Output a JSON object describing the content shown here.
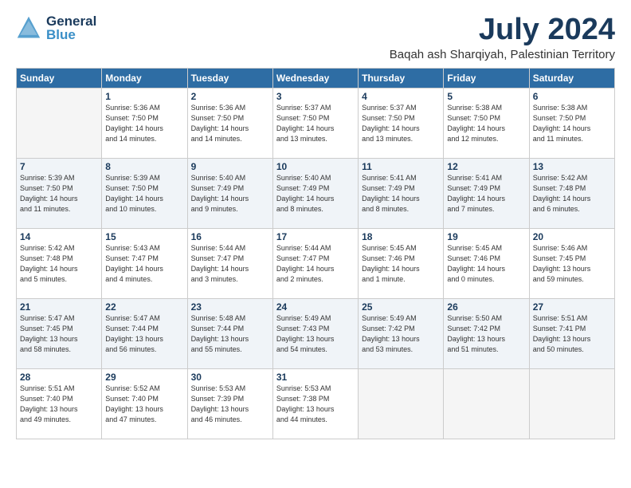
{
  "header": {
    "logo_general": "General",
    "logo_blue": "Blue",
    "month_title": "July 2024",
    "location": "Baqah ash Sharqiyah, Palestinian Territory"
  },
  "days_of_week": [
    "Sunday",
    "Monday",
    "Tuesday",
    "Wednesday",
    "Thursday",
    "Friday",
    "Saturday"
  ],
  "weeks": [
    [
      {
        "day": "",
        "info": ""
      },
      {
        "day": "1",
        "info": "Sunrise: 5:36 AM\nSunset: 7:50 PM\nDaylight: 14 hours\nand 14 minutes."
      },
      {
        "day": "2",
        "info": "Sunrise: 5:36 AM\nSunset: 7:50 PM\nDaylight: 14 hours\nand 14 minutes."
      },
      {
        "day": "3",
        "info": "Sunrise: 5:37 AM\nSunset: 7:50 PM\nDaylight: 14 hours\nand 13 minutes."
      },
      {
        "day": "4",
        "info": "Sunrise: 5:37 AM\nSunset: 7:50 PM\nDaylight: 14 hours\nand 13 minutes."
      },
      {
        "day": "5",
        "info": "Sunrise: 5:38 AM\nSunset: 7:50 PM\nDaylight: 14 hours\nand 12 minutes."
      },
      {
        "day": "6",
        "info": "Sunrise: 5:38 AM\nSunset: 7:50 PM\nDaylight: 14 hours\nand 11 minutes."
      }
    ],
    [
      {
        "day": "7",
        "info": "Sunrise: 5:39 AM\nSunset: 7:50 PM\nDaylight: 14 hours\nand 11 minutes."
      },
      {
        "day": "8",
        "info": "Sunrise: 5:39 AM\nSunset: 7:50 PM\nDaylight: 14 hours\nand 10 minutes."
      },
      {
        "day": "9",
        "info": "Sunrise: 5:40 AM\nSunset: 7:49 PM\nDaylight: 14 hours\nand 9 minutes."
      },
      {
        "day": "10",
        "info": "Sunrise: 5:40 AM\nSunset: 7:49 PM\nDaylight: 14 hours\nand 8 minutes."
      },
      {
        "day": "11",
        "info": "Sunrise: 5:41 AM\nSunset: 7:49 PM\nDaylight: 14 hours\nand 8 minutes."
      },
      {
        "day": "12",
        "info": "Sunrise: 5:41 AM\nSunset: 7:49 PM\nDaylight: 14 hours\nand 7 minutes."
      },
      {
        "day": "13",
        "info": "Sunrise: 5:42 AM\nSunset: 7:48 PM\nDaylight: 14 hours\nand 6 minutes."
      }
    ],
    [
      {
        "day": "14",
        "info": "Sunrise: 5:42 AM\nSunset: 7:48 PM\nDaylight: 14 hours\nand 5 minutes."
      },
      {
        "day": "15",
        "info": "Sunrise: 5:43 AM\nSunset: 7:47 PM\nDaylight: 14 hours\nand 4 minutes."
      },
      {
        "day": "16",
        "info": "Sunrise: 5:44 AM\nSunset: 7:47 PM\nDaylight: 14 hours\nand 3 minutes."
      },
      {
        "day": "17",
        "info": "Sunrise: 5:44 AM\nSunset: 7:47 PM\nDaylight: 14 hours\nand 2 minutes."
      },
      {
        "day": "18",
        "info": "Sunrise: 5:45 AM\nSunset: 7:46 PM\nDaylight: 14 hours\nand 1 minute."
      },
      {
        "day": "19",
        "info": "Sunrise: 5:45 AM\nSunset: 7:46 PM\nDaylight: 14 hours\nand 0 minutes."
      },
      {
        "day": "20",
        "info": "Sunrise: 5:46 AM\nSunset: 7:45 PM\nDaylight: 13 hours\nand 59 minutes."
      }
    ],
    [
      {
        "day": "21",
        "info": "Sunrise: 5:47 AM\nSunset: 7:45 PM\nDaylight: 13 hours\nand 58 minutes."
      },
      {
        "day": "22",
        "info": "Sunrise: 5:47 AM\nSunset: 7:44 PM\nDaylight: 13 hours\nand 56 minutes."
      },
      {
        "day": "23",
        "info": "Sunrise: 5:48 AM\nSunset: 7:44 PM\nDaylight: 13 hours\nand 55 minutes."
      },
      {
        "day": "24",
        "info": "Sunrise: 5:49 AM\nSunset: 7:43 PM\nDaylight: 13 hours\nand 54 minutes."
      },
      {
        "day": "25",
        "info": "Sunrise: 5:49 AM\nSunset: 7:42 PM\nDaylight: 13 hours\nand 53 minutes."
      },
      {
        "day": "26",
        "info": "Sunrise: 5:50 AM\nSunset: 7:42 PM\nDaylight: 13 hours\nand 51 minutes."
      },
      {
        "day": "27",
        "info": "Sunrise: 5:51 AM\nSunset: 7:41 PM\nDaylight: 13 hours\nand 50 minutes."
      }
    ],
    [
      {
        "day": "28",
        "info": "Sunrise: 5:51 AM\nSunset: 7:40 PM\nDaylight: 13 hours\nand 49 minutes."
      },
      {
        "day": "29",
        "info": "Sunrise: 5:52 AM\nSunset: 7:40 PM\nDaylight: 13 hours\nand 47 minutes."
      },
      {
        "day": "30",
        "info": "Sunrise: 5:53 AM\nSunset: 7:39 PM\nDaylight: 13 hours\nand 46 minutes."
      },
      {
        "day": "31",
        "info": "Sunrise: 5:53 AM\nSunset: 7:38 PM\nDaylight: 13 hours\nand 44 minutes."
      },
      {
        "day": "",
        "info": ""
      },
      {
        "day": "",
        "info": ""
      },
      {
        "day": "",
        "info": ""
      }
    ]
  ]
}
